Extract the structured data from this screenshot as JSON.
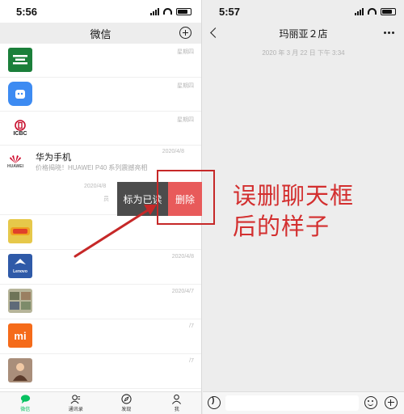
{
  "left": {
    "status_time": "5:56",
    "nav_title": "微信",
    "chats": [
      {
        "avatar_text": "",
        "avatar_color": "#1b7f3a",
        "time": "星期四",
        "name": "",
        "preview": ""
      },
      {
        "avatar_text": "",
        "avatar_color": "#3d8bf2",
        "time": "星期四",
        "name": "",
        "preview": ""
      },
      {
        "avatar_text": "ICBC",
        "avatar_color": "#c8102e",
        "time": "星期四",
        "name": "",
        "preview": ""
      },
      {
        "avatar_text": "HUAWEI",
        "avatar_color": "#cf0a2c",
        "time": "2020/4/8",
        "name": "华为手机",
        "preview": "价格揭晓！HUAWEI P40 系列震撼亮相",
        "swipe_time": "2020/4/8",
        "swipe_faint": "员"
      },
      {
        "avatar_text": "",
        "avatar_color": "#e6c84a",
        "time": "",
        "name": "",
        "preview": ""
      },
      {
        "avatar_text": "Lenovo",
        "avatar_color": "#2f5aa8",
        "time": "2020/4/8",
        "name": "",
        "preview": ""
      },
      {
        "avatar_text": "",
        "avatar_color": "#8a8f6e",
        "time": "2020/4/7",
        "name": "",
        "preview": ""
      },
      {
        "avatar_text": "mi",
        "avatar_color": "#f56b1a",
        "time": "/7",
        "name": "",
        "preview": ""
      },
      {
        "avatar_text": "",
        "avatar_color": "#8a5a3c",
        "time": "/7",
        "name": "",
        "preview": ""
      }
    ],
    "swipe_actions": {
      "mark_read": "标为已读",
      "delete": "删除"
    },
    "tabs": [
      {
        "label": "微信",
        "icon": "chat-bubble-icon"
      },
      {
        "label": "通讯录",
        "icon": "contacts-icon"
      },
      {
        "label": "发现",
        "icon": "compass-icon"
      },
      {
        "label": "我",
        "icon": "person-icon"
      }
    ]
  },
  "right": {
    "status_time": "5:57",
    "nav_title": "玛丽亚２店",
    "chat_timestamp": "2020 年 3 月 22 日 下午 3:34"
  },
  "annotation": {
    "line1": "误删聊天框",
    "line2": "后的样子",
    "color": "#d32f2f"
  }
}
